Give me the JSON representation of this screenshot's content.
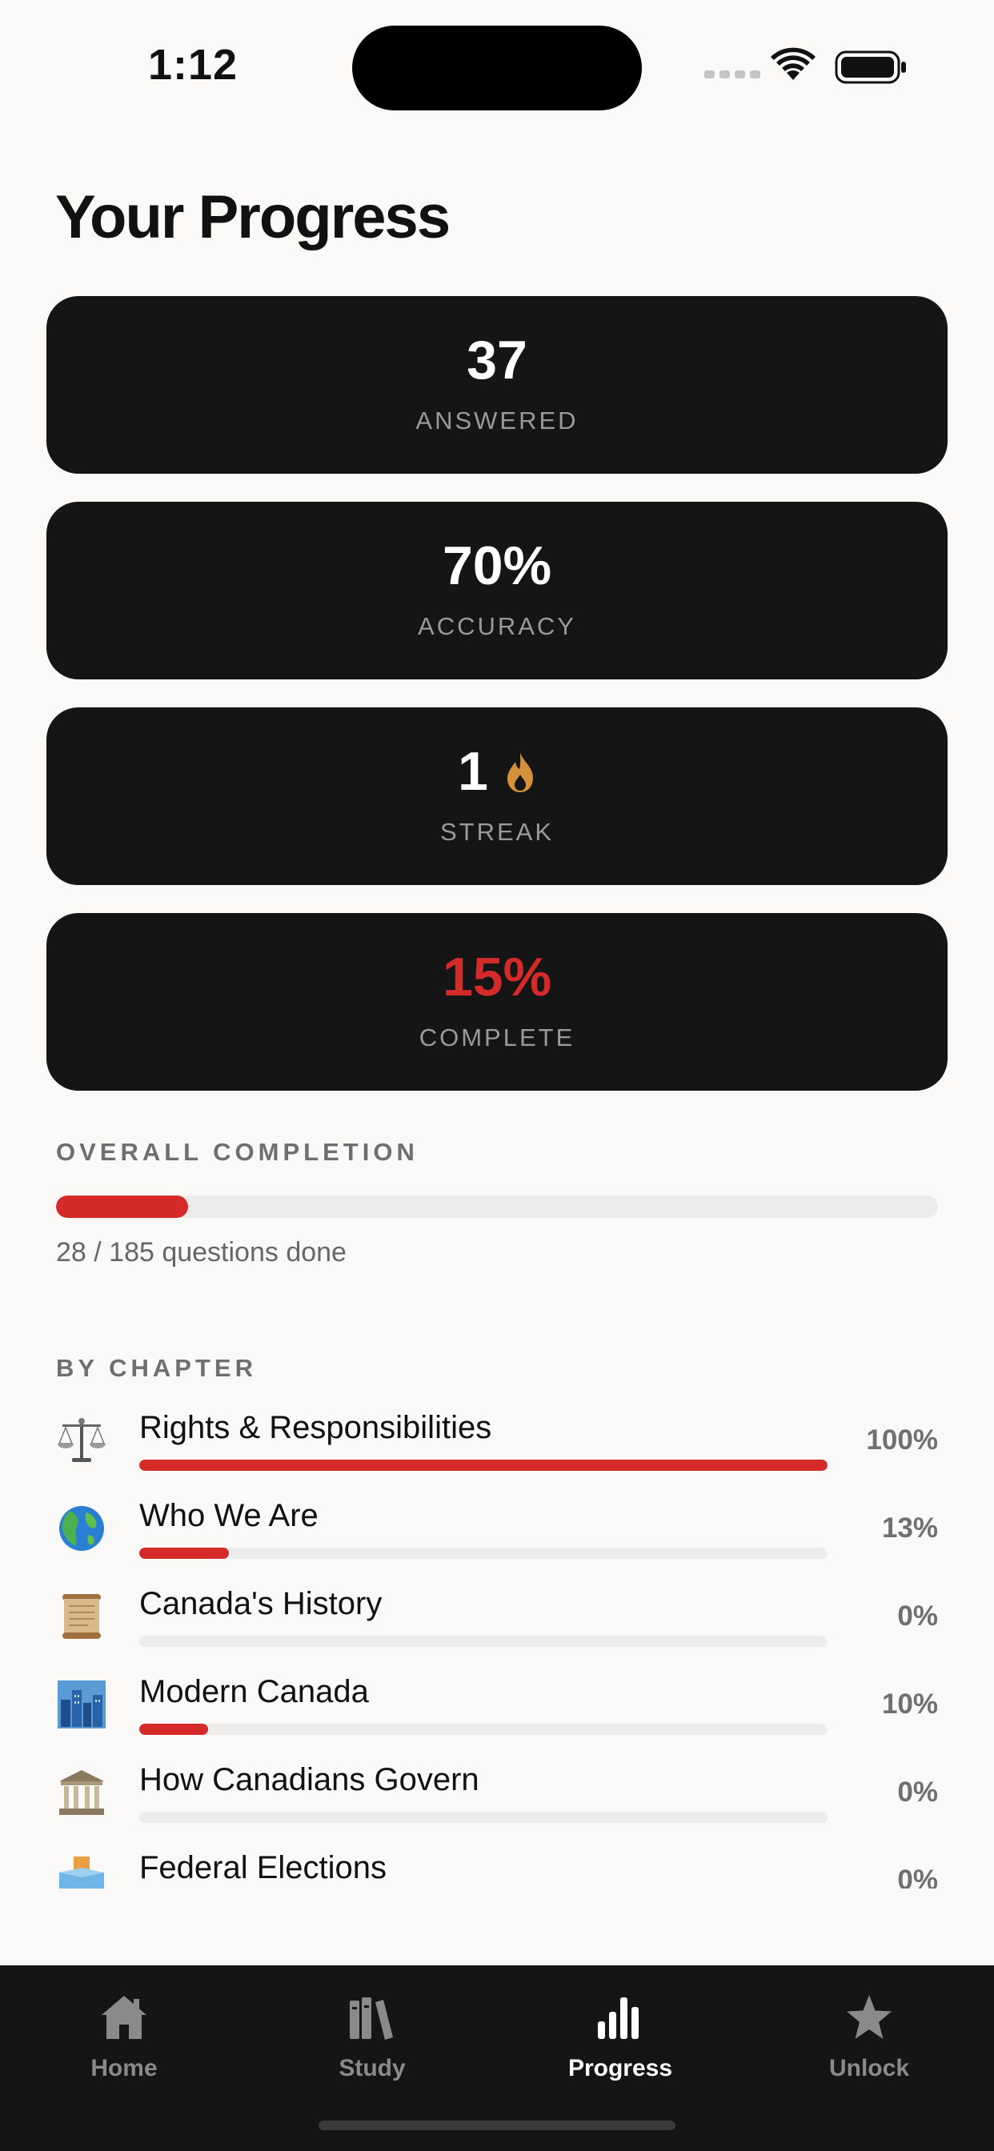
{
  "status_bar": {
    "time": "1:12"
  },
  "page": {
    "title": "Your Progress"
  },
  "stats": [
    {
      "value": "37",
      "label": "ANSWERED",
      "color": "#ffffff"
    },
    {
      "value": "70%",
      "label": "ACCURACY",
      "color": "#ffffff"
    },
    {
      "value": "1",
      "label": "STREAK",
      "icon": "flame-icon",
      "color": "#ffffff"
    },
    {
      "value": "15%",
      "label": "COMPLETE",
      "color": "#d52a2a"
    }
  ],
  "overall": {
    "heading": "OVERALL COMPLETION",
    "caption": "28 / 185 questions done",
    "progress": 0.15
  },
  "chapters": {
    "heading": "BY CHAPTER",
    "items": [
      {
        "icon": "scales-icon",
        "title": "Rights & Responsibilities",
        "percent_label": "100%",
        "progress": 1.0
      },
      {
        "icon": "globe-icon",
        "title": "Who We Are",
        "percent_label": "13%",
        "progress": 0.13
      },
      {
        "icon": "scroll-icon",
        "title": "Canada's History",
        "percent_label": "0%",
        "progress": 0.0
      },
      {
        "icon": "cityscape-icon",
        "title": "Modern Canada",
        "percent_label": "10%",
        "progress": 0.1
      },
      {
        "icon": "government-building-icon",
        "title": "How Canadians Govern",
        "percent_label": "0%",
        "progress": 0.0
      },
      {
        "icon": "ballot-box-icon",
        "title": "Federal Elections",
        "percent_label": "0%",
        "progress": 0.0
      }
    ]
  },
  "tab_bar": {
    "items": [
      {
        "label": "Home",
        "icon": "home-icon",
        "active": false
      },
      {
        "label": "Study",
        "icon": "books-icon",
        "active": false
      },
      {
        "label": "Progress",
        "icon": "bar-chart-icon",
        "active": true
      },
      {
        "label": "Unlock",
        "icon": "star-icon",
        "active": false
      }
    ]
  },
  "colors": {
    "accent": "#d52a2a",
    "card_background": "#151515",
    "page_background": "#faf9f7",
    "flame": "#d4913a"
  }
}
